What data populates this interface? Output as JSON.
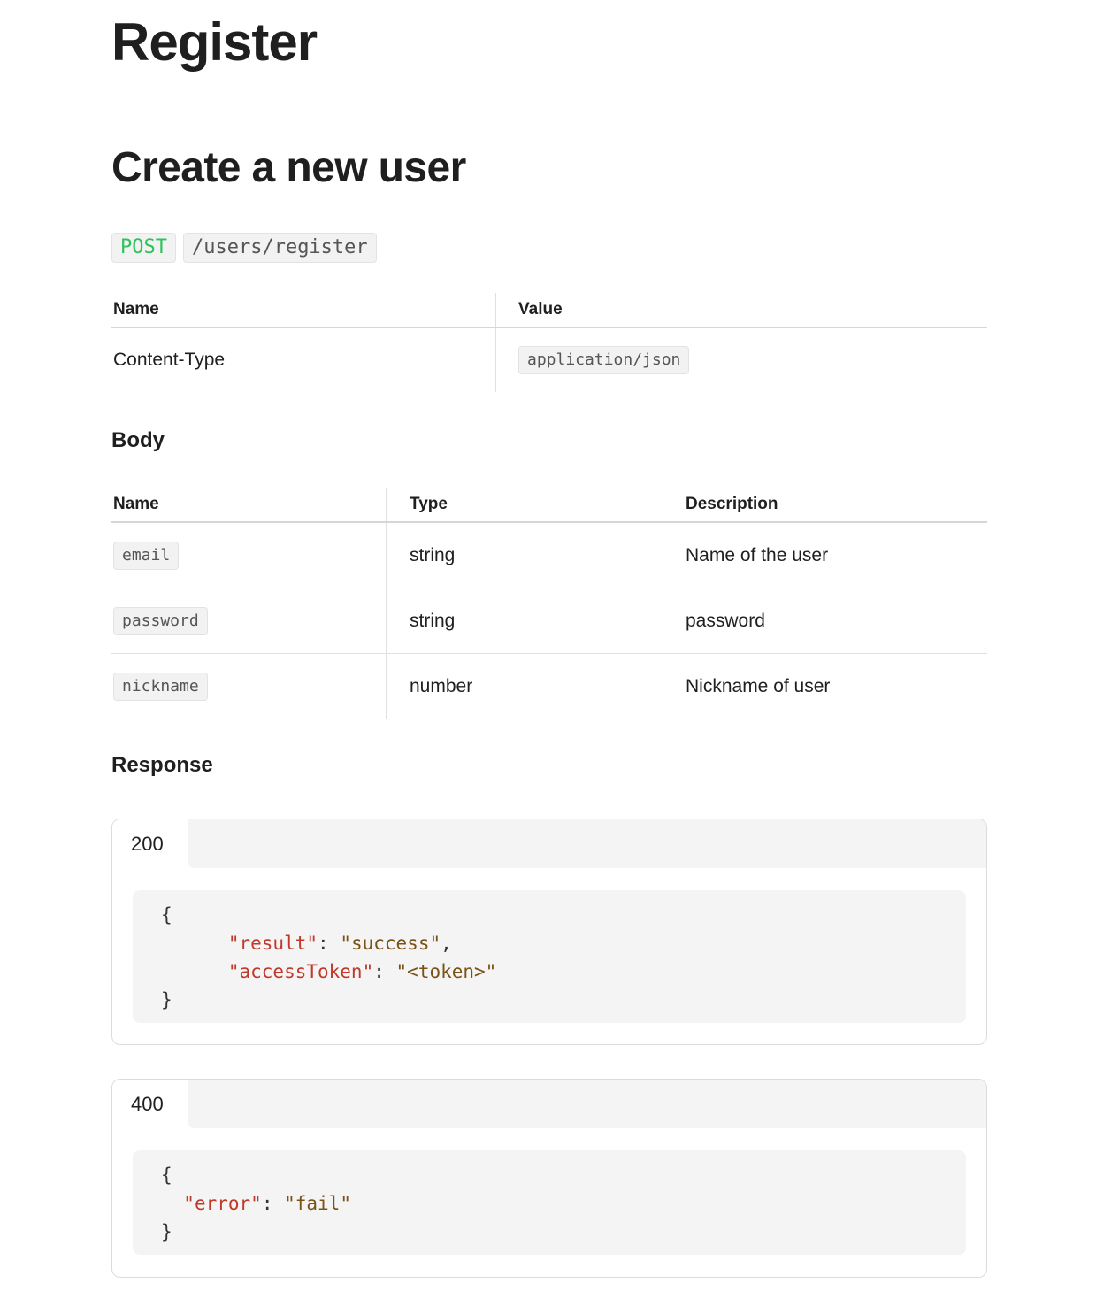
{
  "page": {
    "title": "Register",
    "section_title": "Create a new user"
  },
  "endpoint": {
    "method": "POST",
    "path": "/users/register"
  },
  "headers_table": {
    "columns": [
      "Name",
      "Value"
    ],
    "rows": [
      {
        "name": "Content-Type",
        "value": "application/json"
      }
    ]
  },
  "body": {
    "heading": "Body",
    "columns": [
      "Name",
      "Type",
      "Description"
    ],
    "rows": [
      {
        "name": "email",
        "type": "string",
        "description": "Name of the user"
      },
      {
        "name": "password",
        "type": "string",
        "description": "password"
      },
      {
        "name": "nickname",
        "type": "number",
        "description": "Nickname of user"
      }
    ]
  },
  "response": {
    "heading": "Response",
    "items": [
      {
        "status": "200",
        "open_brace": "{",
        "close_brace": "}",
        "lines": [
          {
            "key": "\"result\"",
            "colon": ": ",
            "value": "\"success\"",
            "trail": ","
          },
          {
            "key": "\"accessToken\"",
            "colon": ": ",
            "value": "\"<token>\"",
            "trail": ""
          }
        ]
      },
      {
        "status": "400",
        "open_brace": "{",
        "close_brace": "}",
        "lines": [
          {
            "key": "\"error\"",
            "colon": ": ",
            "value": "\"fail\"",
            "trail": ""
          }
        ]
      }
    ]
  }
}
